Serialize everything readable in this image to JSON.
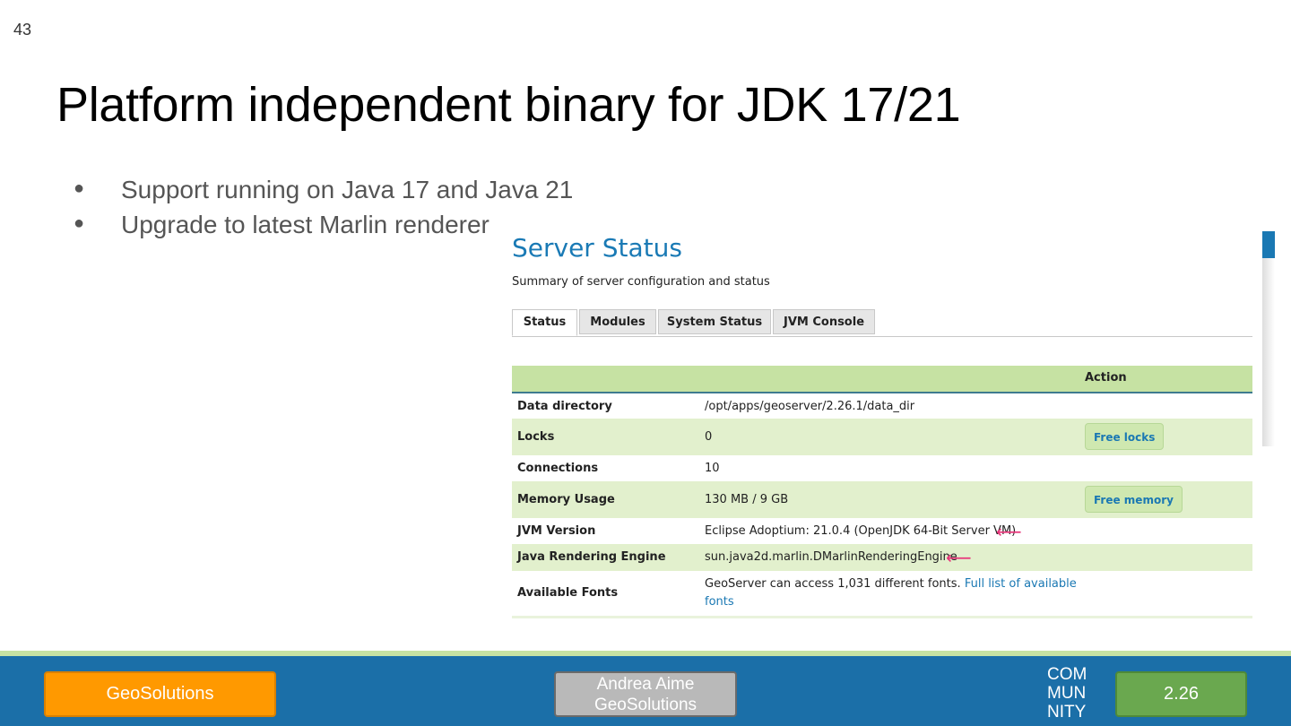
{
  "slide": {
    "number": "43",
    "title": "Platform independent binary for JDK 17/21",
    "bullets": [
      "Support running on Java 17 and Java 21",
      "Upgrade to latest Marlin renderer"
    ],
    "bullet_glyph": "●"
  },
  "server_status": {
    "title": "Server Status",
    "summary": "Summary of server configuration and status",
    "tabs": [
      "Status",
      "Modules",
      "System Status",
      "JVM Console"
    ],
    "active_tab": "Status",
    "action_header": "Action",
    "rows": [
      {
        "key": "Data directory",
        "value": "/opt/apps/geoserver/2.26.1/data_dir"
      },
      {
        "key": "Locks",
        "value": "0",
        "action": "Free locks"
      },
      {
        "key": "Connections",
        "value": "10"
      },
      {
        "key": "Memory Usage",
        "value": "130 MB / 9 GB",
        "action": "Free memory"
      },
      {
        "key": "JVM Version",
        "value": "Eclipse Adoptium: 21.0.4 (OpenJDK 64-Bit Server VM)"
      },
      {
        "key": "Java Rendering Engine",
        "value": "sun.java2d.marlin.DMarlinRenderingEngine"
      },
      {
        "key": "Available Fonts",
        "value": "GeoServer can access 1,031 different fonts.",
        "link_line1": "Full list of available",
        "link_line2": "fonts"
      }
    ],
    "arrow_icon": "arrow-left-icon",
    "arrow_glyph": "⟵",
    "accent_color": "#1a7ab5",
    "arrow_color": "#e8357a"
  },
  "footer": {
    "company": "GeoSolutions",
    "author_name": "Andrea Aime",
    "author_org": "GeoSolutions",
    "community_lines": [
      "COM",
      "MUN",
      "NITY"
    ],
    "version": "2.26",
    "bar_color": "#1b6fa8"
  }
}
